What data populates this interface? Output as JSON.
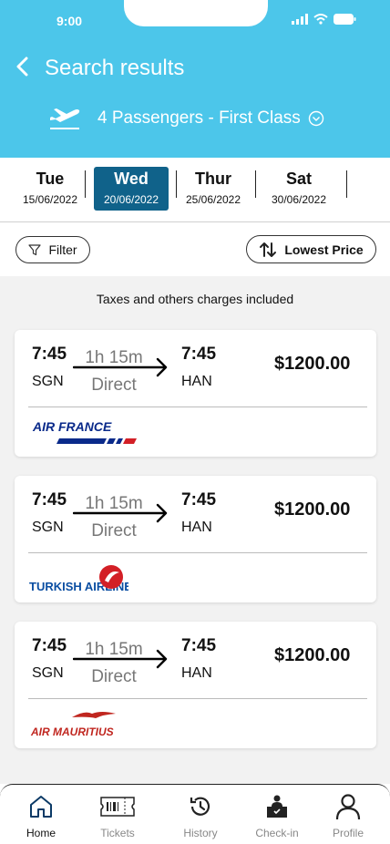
{
  "status": {
    "time": "9:00"
  },
  "header": {
    "title": "Search results",
    "passengers": "4 Passengers - First Class"
  },
  "dates": [
    {
      "day": "Tue",
      "date": "15/06/2022",
      "active": false
    },
    {
      "day": "Wed",
      "date": "20/06/2022",
      "active": true
    },
    {
      "day": "Thur",
      "date": "25/06/2022",
      "active": false
    },
    {
      "day": "Sat",
      "date": "30/06/2022",
      "active": false
    }
  ],
  "filter": {
    "label": "Filter"
  },
  "sort": {
    "label": "Lowest Price"
  },
  "results": {
    "tax_note": "Taxes and others charges included",
    "flights": [
      {
        "dep_time": "7:45",
        "dep_code": "SGN",
        "duration": "1h 15m",
        "stops": "Direct",
        "arr_time": "7:45",
        "arr_code": "HAN",
        "price": "$1200.00",
        "airline": "AIR FRANCE"
      },
      {
        "dep_time": "7:45",
        "dep_code": "SGN",
        "duration": "1h 15m",
        "stops": "Direct",
        "arr_time": "7:45",
        "arr_code": "HAN",
        "price": "$1200.00",
        "airline": "TURKISH AIRLINES"
      },
      {
        "dep_time": "7:45",
        "dep_code": "SGN",
        "duration": "1h 15m",
        "stops": "Direct",
        "arr_time": "7:45",
        "arr_code": "HAN",
        "price": "$1200.00",
        "airline": "AIR MAURITIUS"
      }
    ]
  },
  "nav": [
    {
      "label": "Home",
      "icon": "home-icon",
      "active": true
    },
    {
      "label": "Tickets",
      "icon": "ticket-icon",
      "active": false
    },
    {
      "label": "History",
      "icon": "history-icon",
      "active": false
    },
    {
      "label": "Check-in",
      "icon": "check-in-icon",
      "active": false
    },
    {
      "label": "Profile",
      "icon": "profile-icon",
      "active": false
    }
  ],
  "colors": {
    "header": "#4cc6ea",
    "active_date": "#10628a",
    "results_bg": "#f2f2f2"
  }
}
